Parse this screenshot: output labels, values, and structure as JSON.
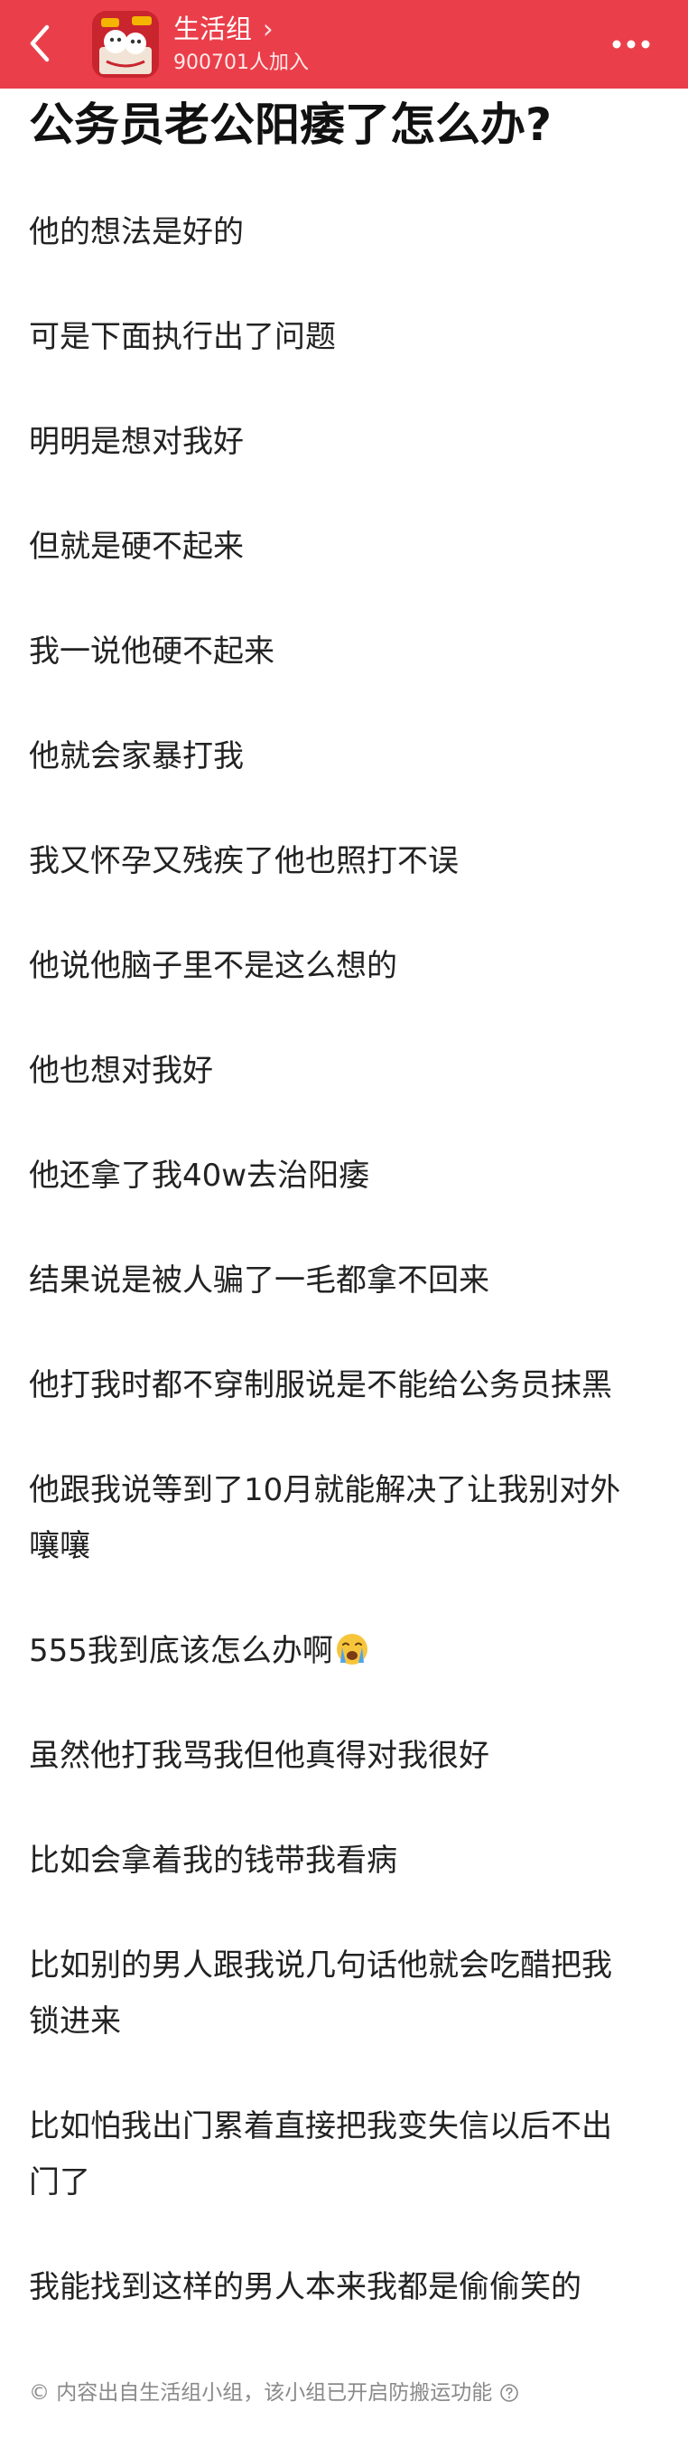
{
  "header": {
    "group_name": "生活组",
    "chevron": "›",
    "members": "900701人加入",
    "icons": {
      "back": "chevron-left-icon",
      "more": "more-dots-icon"
    },
    "colors": {
      "bar": "#ea3f4a",
      "text": "#ffffff"
    }
  },
  "post": {
    "title": "公务员老公阳痿了怎么办?",
    "lines": [
      "他的想法是好的",
      "可是下面执行出了问题",
      "明明是想对我好",
      "但就是硬不起来",
      "我一说他硬不起来",
      "他就会家暴打我",
      "我又怀孕又残疾了他也照打不误",
      "他说他脑子里不是这么想的",
      "他也想对我好",
      "他还拿了我40w去治阳痿",
      "结果说是被人骗了一毛都拿不回来",
      "他打我时都不穿制服说是不能给公务员抹黑",
      "他跟我说等到了10月就能解决了让我别对外",
      "嚷嚷",
      "555我到底该怎么办啊",
      "虽然他打我骂我但他真得对我很好",
      "比如会拿着我的钱带我看病",
      "比如别的男人跟我说几句话他就会吃醋把我",
      "锁进来",
      "比如怕我出门累着直接把我变失信以后不出",
      "门了",
      "我能找到这样的男人本来我都是偷偷笑的"
    ],
    "emoji": "crying-face-icon"
  },
  "footer": {
    "note": "© 内容出自生活组小组，该小组已开启防搬运功能",
    "icon": "question-circle-icon"
  }
}
